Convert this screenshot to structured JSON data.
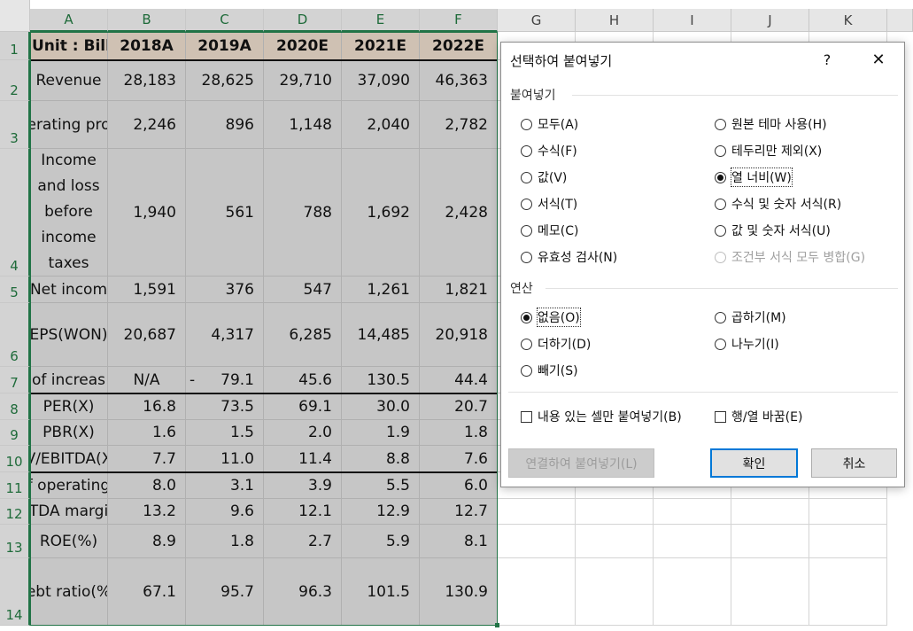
{
  "columns": [
    "A",
    "B",
    "C",
    "D",
    "E",
    "F",
    "G",
    "H",
    "I",
    "J",
    "K"
  ],
  "rows": [
    "1",
    "2",
    "3",
    "4",
    "5",
    "6",
    "7",
    "8",
    "9",
    "10",
    "11",
    "12",
    "13",
    "14"
  ],
  "table": {
    "header": [
      "Unit : Billio",
      "2018A",
      "2019A",
      "2020E",
      "2021E",
      "2022E"
    ],
    "body": [
      [
        "Revenue",
        "28,183",
        "28,625",
        "29,710",
        "37,090",
        "46,363"
      ],
      [
        "erating pro",
        "2,246",
        "896",
        "1,148",
        "2,040",
        "2,782"
      ],
      [
        "Income and loss before income taxes",
        "1,940",
        "561",
        "788",
        "1,692",
        "2,428"
      ],
      [
        "Net incom",
        "1,591",
        "376",
        "547",
        "1,261",
        "1,821"
      ],
      [
        "EPS(WON)",
        "20,687",
        "4,317",
        "6,285",
        "14,485",
        "20,918"
      ],
      [
        "of increas",
        "N/A",
        "-     79.1",
        "45.6",
        "130.5",
        "44.4"
      ],
      [
        "PER(X)",
        "16.8",
        "73.5",
        "69.1",
        "30.0",
        "20.7"
      ],
      [
        "PBR(X)",
        "1.6",
        "1.5",
        "2.0",
        "1.9",
        "1.8"
      ],
      [
        "V/EBITDA(X",
        "7.7",
        "11.0",
        "11.4",
        "8.8",
        "7.6"
      ],
      [
        "f operating",
        "8.0",
        "3.1",
        "3.9",
        "5.5",
        "6.0"
      ],
      [
        "TDA margi",
        "13.2",
        "9.6",
        "12.1",
        "12.9",
        "12.7"
      ],
      [
        "ROE(%)",
        "8.9",
        "1.8",
        "2.7",
        "5.9",
        "8.1"
      ],
      [
        "ebt ratio(%",
        "67.1",
        "95.7",
        "96.3",
        "101.5",
        "130.9"
      ]
    ]
  },
  "dialog": {
    "title": "선택하여 붙여넣기",
    "help": "?",
    "close": "✕",
    "paste_group": "붙여넣기",
    "paste_options_left": [
      "모두(A)",
      "수식(F)",
      "값(V)",
      "서식(T)",
      "메모(C)",
      "유효성 검사(N)"
    ],
    "paste_options_right": [
      "원본 테마 사용(H)",
      "테두리만 제외(X)",
      "열 너비(W)",
      "수식 및 숫자 서식(R)",
      "값 및 숫자 서식(U)",
      "조건부 서식 모두 병합(G)"
    ],
    "paste_selected": "열 너비(W)",
    "op_group": "연산",
    "op_options_left": [
      "없음(O)",
      "더하기(D)",
      "빼기(S)"
    ],
    "op_options_right": [
      "곱하기(M)",
      "나누기(I)"
    ],
    "op_selected": "없음(O)",
    "check_skip_blanks": "내용 있는 셀만 붙여넣기(B)",
    "check_transpose": "행/열 바꿈(E)",
    "paste_link_button": "연결하여 붙여넣기(L)",
    "ok_button": "확인",
    "cancel_button": "취소"
  }
}
